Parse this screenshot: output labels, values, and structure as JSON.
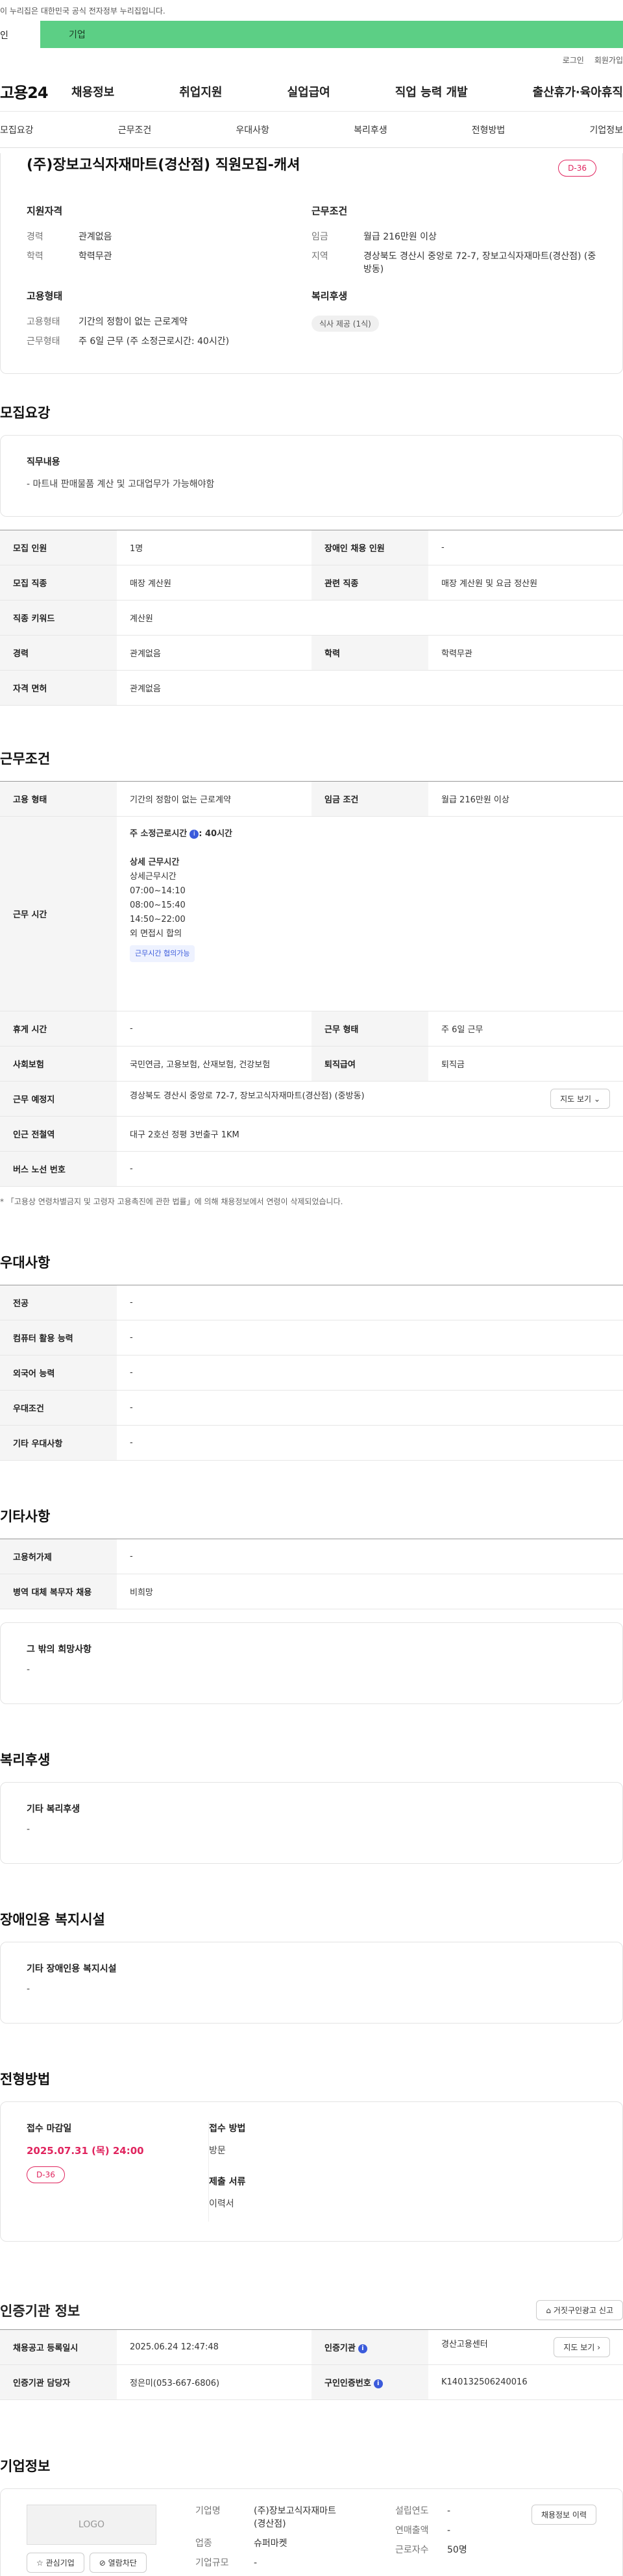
{
  "gov_banner": "이 누리집은 대한민국 공식 전자정부 누리집입니다.",
  "topbar": {
    "left": "인",
    "tab": "기업"
  },
  "util": [
    "로그인",
    "회원가입"
  ],
  "logo": "고용24",
  "gnb": [
    "채용정보",
    "취업지원",
    "실업급여",
    "직업 능력 개발",
    "출산휴가·육아휴직"
  ],
  "subtabs": [
    "모집요강",
    "근무조건",
    "우대사항",
    "복리후생",
    "전형방법",
    "기업정보"
  ],
  "header": {
    "title": "(주)장보고식자재마트(경산점) 직원모집-캐셔",
    "dday": "D-36",
    "qual_title": "지원자격",
    "qual": [
      {
        "k": "경력",
        "v": "관계없음"
      },
      {
        "k": "학력",
        "v": "학력무관"
      }
    ],
    "cond_title": "근무조건",
    "cond": [
      {
        "k": "임금",
        "v": "월급 216만원 이상"
      },
      {
        "k": "지역",
        "v": "경상북도 경산시 중앙로 72-7, 장보고식자재마트(경산점) (중방동)"
      }
    ],
    "emp_title": "고용형태",
    "emp": [
      {
        "k": "고용형태",
        "v": "기간의 정함이 없는 근로계약"
      },
      {
        "k": "근무형태",
        "v": "주 6일 근무 (주 소정근로시간: 40시간)"
      }
    ],
    "welfare_title": "복리후생",
    "welfare_chip": "식사 제공 (1식)"
  },
  "recruit": {
    "title": "모집요강",
    "duty_title": "직무내용",
    "duty": "- 마트내 판매물품 계산 및 고대업무가 가능해야함",
    "rows": [
      [
        "모집 인원",
        "1명",
        "장애인 채용 인원",
        "-"
      ],
      [
        "모집 직종",
        "매장 계산원",
        "관련 직종",
        "매장 계산원 및 요금 정산원"
      ],
      [
        "직종 키워드",
        "계산원",
        "",
        ""
      ],
      [
        "경력",
        "관계없음",
        "학력",
        "학력무관"
      ],
      [
        "자격 면허",
        "관계없음",
        "",
        ""
      ]
    ]
  },
  "work": {
    "title": "근무조건",
    "emp_label": "고용 형태",
    "emp_value": "기간의 정함이 없는 근로계약",
    "wage_label": "임금 조건",
    "wage_value": "월급 216만원 이상",
    "time_label": "근무 시간",
    "time_main": "주 소정근로시간",
    "time_hours": ": 40시간",
    "time_lines": [
      "상세 근무시간",
      "상세근무시간",
      "07:00~14:10",
      "08:00~15:40",
      "14:50~22:00",
      "외 면접시 합의"
    ],
    "time_chip": "근무시간 협의가능",
    "rows": [
      [
        "휴게 시간",
        "-",
        "근무 형태",
        "주 6일 근무"
      ],
      [
        "사회보험",
        "국민연금, 고용보험, 산재보험, 건강보험",
        "퇴직급여",
        "퇴직금"
      ]
    ],
    "place_label": "근무 예정지",
    "place_value": "경상북도 경산시 중앙로 72-7, 장보고식자재마트(경산점) (중방동)",
    "map_btn": "지도 보기",
    "station_label": "인근 전철역",
    "station_value": "대구 2호선 정평 3번출구 1KM",
    "bus_label": "버스 노선 번호",
    "bus_value": "-",
    "note": "* 「고용상 연령차별금지 및 고령자 고용촉진에 관한 법률」에 의해 채용정보에서 연령이 삭제되었습니다."
  },
  "pref": {
    "title": "우대사항",
    "rows": [
      [
        "전공",
        "-"
      ],
      [
        "컴퓨터 활용 능력",
        "-"
      ],
      [
        "외국어 능력",
        "-"
      ],
      [
        "우대조건",
        "-"
      ],
      [
        "기타 우대사항",
        "-"
      ]
    ]
  },
  "etc": {
    "title": "기타사항",
    "rows": [
      [
        "고용허가제",
        "-"
      ],
      [
        "병역 대체 복무자 채용",
        "비희망"
      ]
    ],
    "box_title": "그 밖의 희망사항",
    "box_text": "-"
  },
  "welfare": {
    "title": "복리후생",
    "box_title": "기타 복리후생",
    "box_text": "-"
  },
  "disabled": {
    "title": "장애인용 복지시설",
    "box_title": "기타 장애인용 복지시설",
    "box_text": "-"
  },
  "select": {
    "title": "전형방법",
    "deadline_label": "접수 마감일",
    "deadline": "2025.07.31 (목) 24:00",
    "dday": "D-36",
    "method_label": "접수 방법",
    "method": "방문",
    "docs_label": "제출 서류",
    "docs": "이력서"
  },
  "cert": {
    "title": "인증기관 정보",
    "report_btn": "거짓구인광고 신고",
    "r1": [
      "채용공고 등록일시",
      "2025.06.24 12:47:48",
      "인증기관",
      "경산고용센터"
    ],
    "r2": [
      "인증기관 담당자",
      "정은미(053-667-6806)",
      "구인인증번호",
      "K140132506240016"
    ],
    "map_btn": "지도 보기"
  },
  "company": {
    "title": "기업정보",
    "logo": "LOGO",
    "fav_btn": "관심기업",
    "block_btn": "열람차단",
    "info_btn": "채용정보 이력",
    "name_label": "기업명",
    "name": "(주)장보고식자재마트(경산점)",
    "type_label": "업종",
    "type": "슈퍼마켓",
    "size_label": "기업규모",
    "size": "-",
    "year_label": "설립연도",
    "year": "-",
    "sales_label": "연매출액",
    "sales": "-",
    "emp_label": "근로자수",
    "emp": "50명"
  }
}
